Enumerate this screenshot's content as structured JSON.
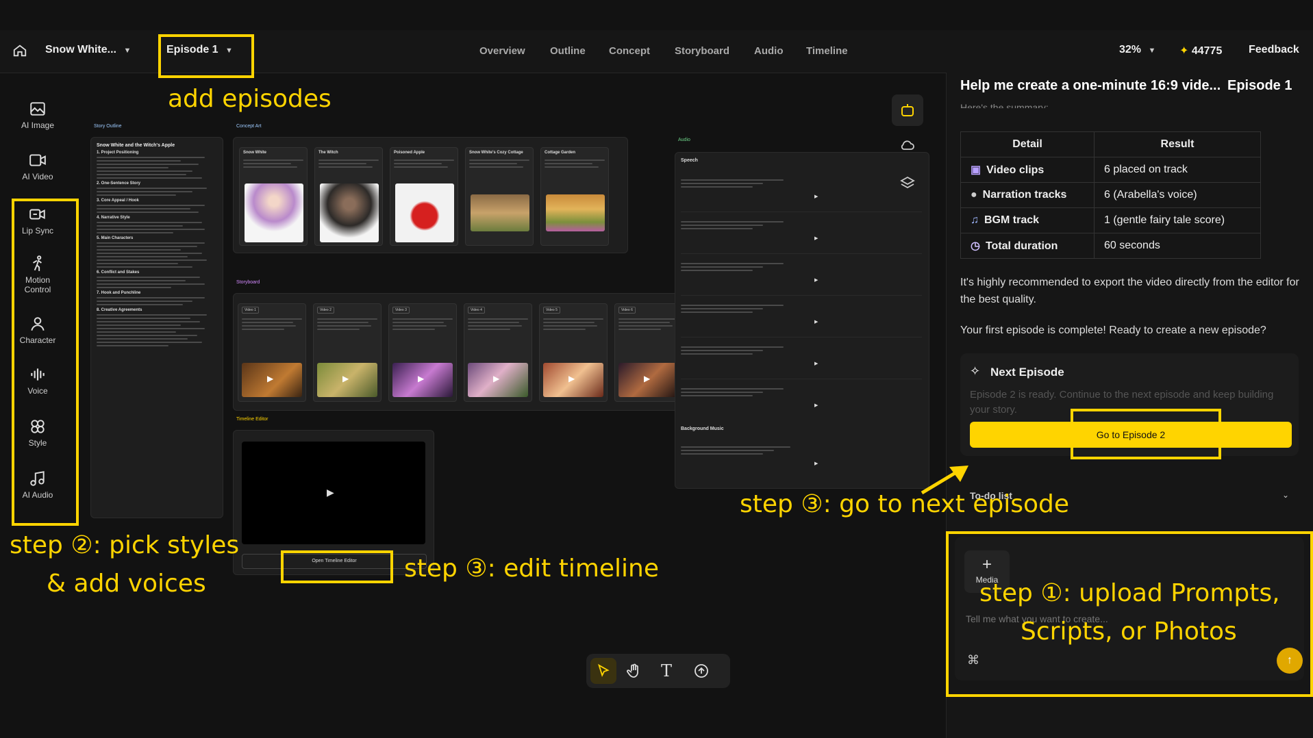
{
  "topbar": {
    "project": "Snow White...",
    "episode": "Episode 1",
    "nav": [
      "Overview",
      "Outline",
      "Concept",
      "Storyboard",
      "Audio",
      "Timeline"
    ],
    "zoom": "32%",
    "credits": "44775",
    "feedback": "Feedback"
  },
  "rail": {
    "items": [
      {
        "label": "AI Image",
        "icon": "ai-image-icon"
      },
      {
        "label": "AI Video",
        "icon": "ai-video-icon"
      },
      {
        "label": "Lip Sync",
        "icon": "lip-sync-icon"
      },
      {
        "label": "Motion Control",
        "icon": "motion-control-icon"
      },
      {
        "label": "Character",
        "icon": "character-icon"
      },
      {
        "label": "Voice",
        "icon": "voice-icon"
      },
      {
        "label": "Style",
        "icon": "style-icon"
      },
      {
        "label": "AI Audio",
        "icon": "ai-audio-icon"
      }
    ]
  },
  "canvas": {
    "story_outline": {
      "title": "Story Outline",
      "heading": "Snow White and the Witch's Apple",
      "sections": [
        "1. Project Positioning",
        "2. One-Sentence Story",
        "3. Core Appeal / Hook",
        "4. Narrative Style",
        "5. Main Characters",
        "6. Conflict and Stakes",
        "7. Hook and Punchline",
        "8. Creative Agreements"
      ]
    },
    "concept_art": {
      "title": "Concept Art",
      "cards": [
        "Snow White",
        "The Witch",
        "Poisoned Apple",
        "Snow White's Cozy Cottage",
        "Cottage Garden"
      ]
    },
    "storyboard": {
      "title": "Storyboard",
      "cards": [
        "Video 1",
        "Video 2",
        "Video 3",
        "Video 4",
        "Video 5",
        "Video 6"
      ]
    },
    "timeline_editor": {
      "title": "Timeline Editor",
      "button": "Open Timeline Editor"
    },
    "audio": {
      "title": "Audio",
      "speech": "Speech",
      "background_music": "Background Music"
    }
  },
  "toolbar": {
    "tools": [
      "select-tool-icon",
      "hand-tool-icon",
      "text-tool-icon",
      "upload-tool-icon"
    ]
  },
  "chat": {
    "title": "Help me create a one-minute 16:9 vide...",
    "episode": "Episode 1",
    "cut_text": "Here's the summary:",
    "table": {
      "headers": [
        "Detail",
        "Result"
      ],
      "rows": [
        {
          "detail": "Video clips",
          "result": "6 placed on track",
          "icon": "video-clip-icon"
        },
        {
          "detail": "Narration tracks",
          "result": "6 (Arabella's voice)",
          "icon": "narration-icon"
        },
        {
          "detail": "BGM track",
          "result": "1 (gentle fairy tale score)",
          "icon": "music-note-icon"
        },
        {
          "detail": "Total duration",
          "result": "60 seconds",
          "icon": "clock-icon"
        }
      ]
    },
    "recommend": "It's highly recommended to export the video directly from the editor for the best quality.",
    "complete": "Your first episode is complete! Ready to create a new episode?",
    "next_card": {
      "title": "Next Episode",
      "desc": "Episode 2 is ready. Continue to the next episode and keep building your story.",
      "button": "Go to Episode 2"
    },
    "todo": "To-do list",
    "composer": {
      "media_label": "Media",
      "placeholder": "Tell me what you want to create..."
    }
  },
  "annotations": {
    "add_episodes": "add episodes",
    "step2_line1": "step ②: pick styles",
    "step2_line2": "& add voices",
    "step3_timeline": "step ③: edit timeline",
    "step3_next": "step ③: go to next episode",
    "step1_line1": "step ①: upload Prompts,",
    "step1_line2": "Scripts, or Photos"
  },
  "colors": {
    "accent": "#ffd400",
    "background": "#121212",
    "panel": "#1e1e1e"
  }
}
